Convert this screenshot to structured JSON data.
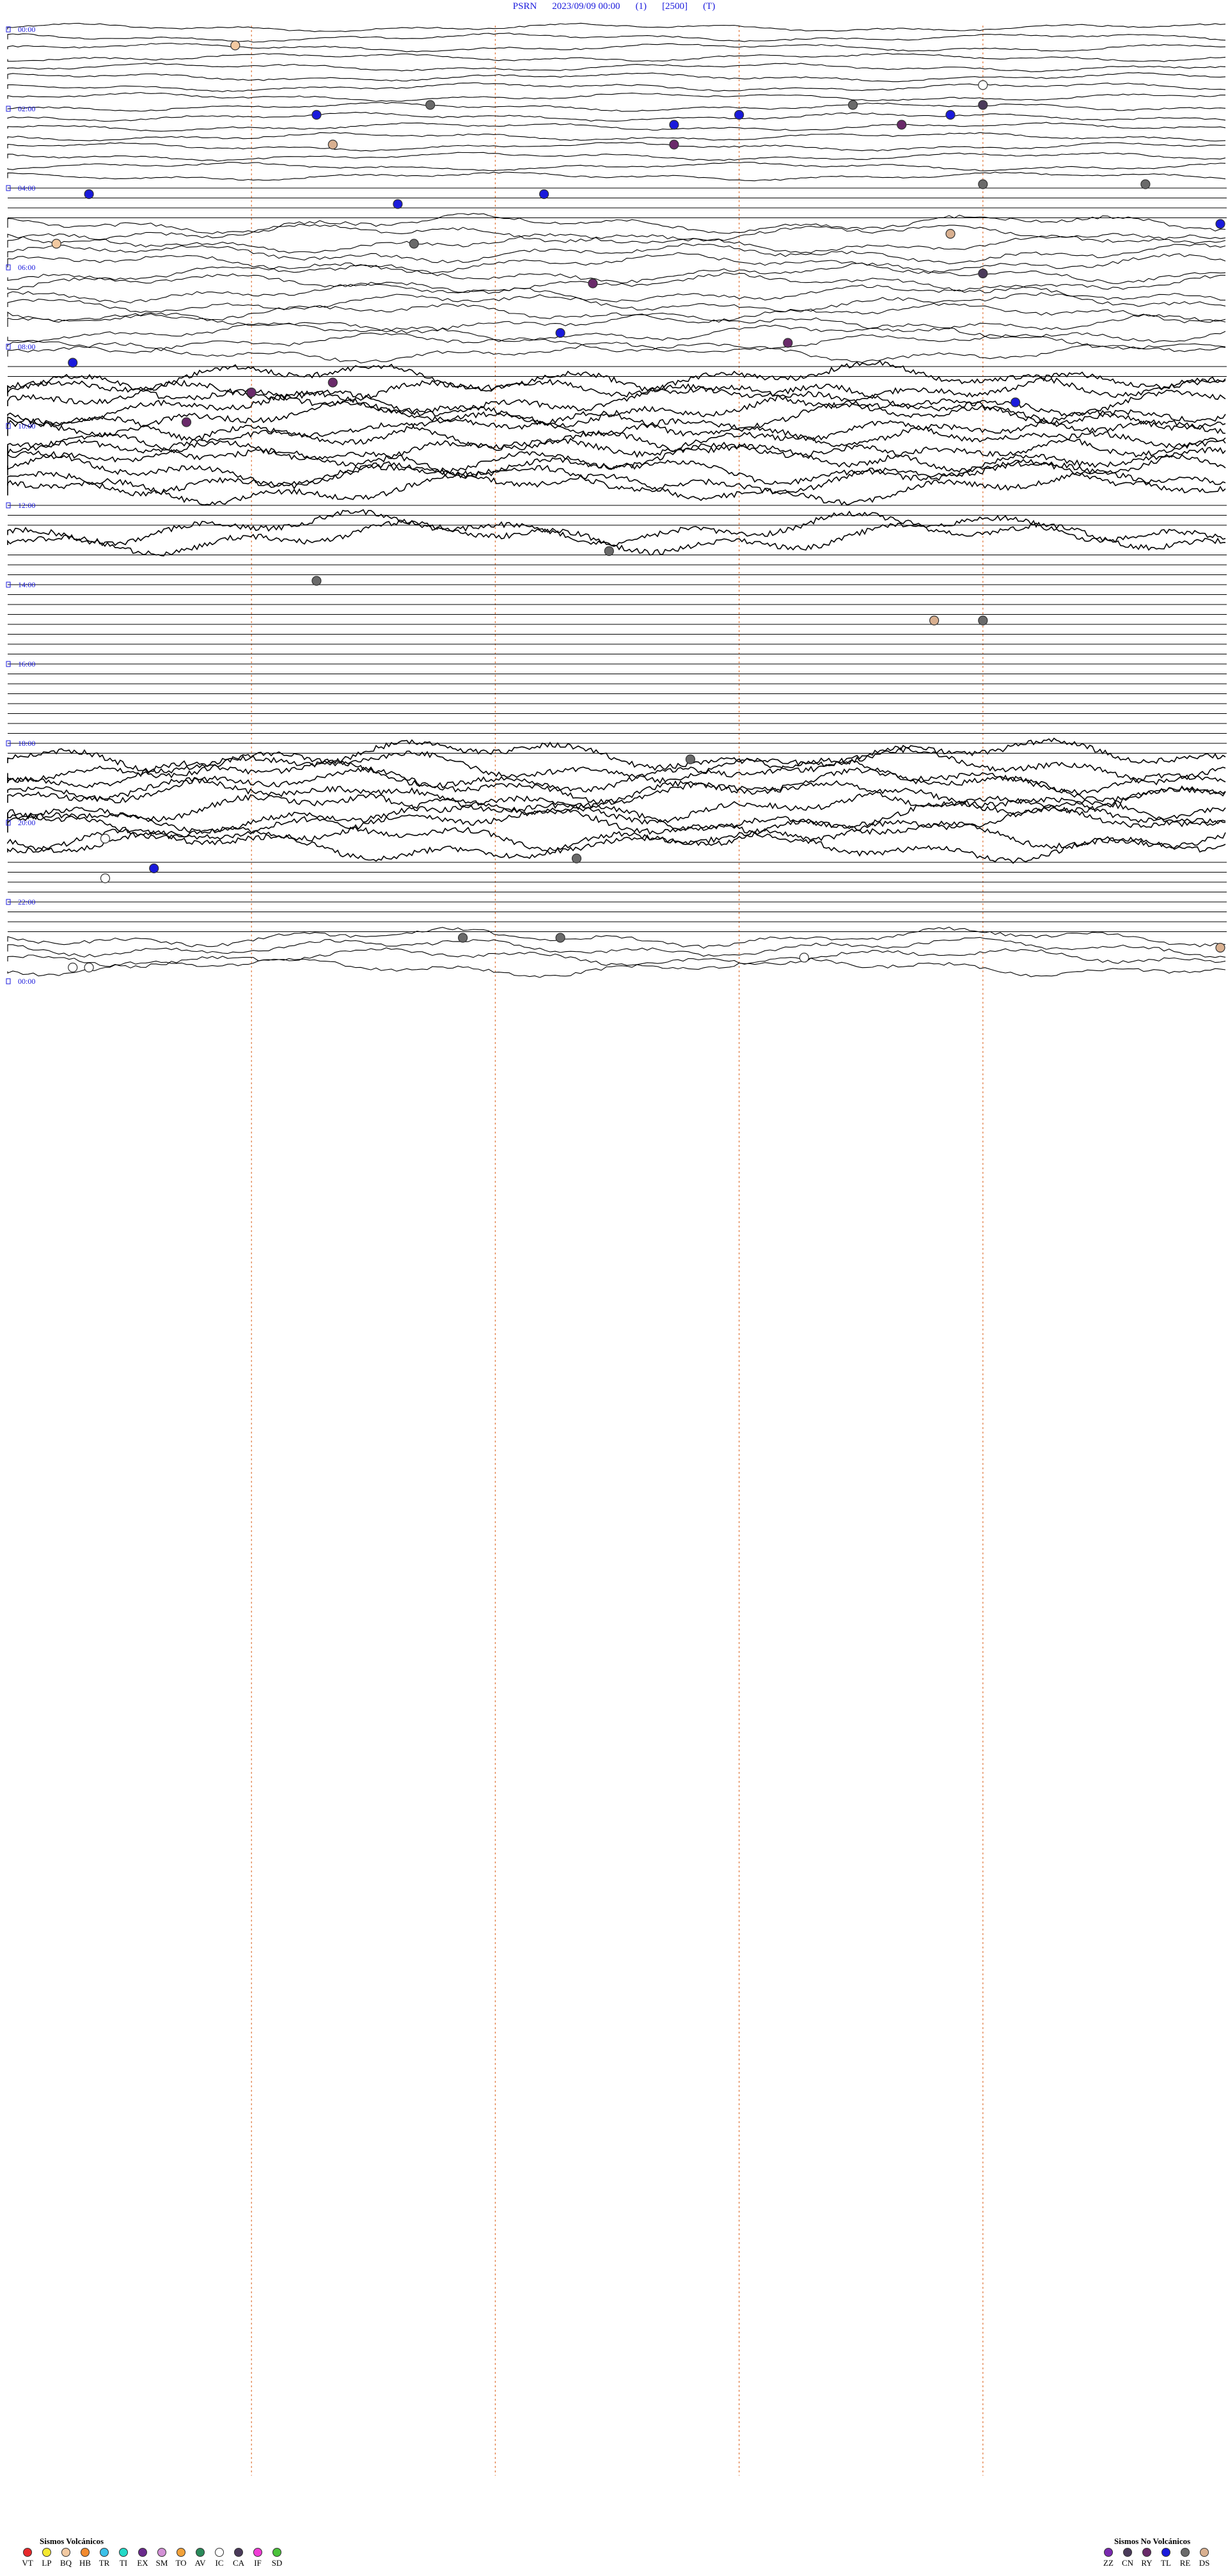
{
  "header": {
    "station": "PSRN",
    "datetime": "2023/09/09 00:00",
    "channel": "(1)",
    "scale": "[2500]",
    "component": "(T)"
  },
  "chart_data": {
    "type": "helicorder",
    "title": "PSRN 2023/09/09 00:00 (1) [2500] (T)",
    "hour_labels": [
      "00:00",
      "02:00",
      "04:00",
      "06:00",
      "08:00",
      "10:00",
      "12:00",
      "14:00",
      "16:00",
      "18:00",
      "20:00",
      "22:00",
      "00:00"
    ],
    "trace_count": 96,
    "minute_marks": 5,
    "line_color": "#000000",
    "label_color": "#1a1adc",
    "marker_color": "#e0763a",
    "activity": [
      {
        "from_hour": 0,
        "to_hour": 2,
        "level": "low"
      },
      {
        "from_hour": 2,
        "to_hour": 4,
        "level": "low"
      },
      {
        "from_hour": 5,
        "to_hour": 7,
        "level": "moderate"
      },
      {
        "from_hour": 7,
        "to_hour": 8.5,
        "level": "moderate"
      },
      {
        "from_hour": 9,
        "to_hour": 12,
        "level": "high"
      },
      {
        "from_hour": 12.7,
        "to_hour": 13.1,
        "level": "high"
      },
      {
        "from_hour": 18.5,
        "to_hour": 21,
        "level": "high"
      },
      {
        "from_hour": 23,
        "to_hour": 24,
        "level": "moderate"
      }
    ],
    "events": [
      {
        "hour": 0.5,
        "minute": 14,
        "type": "BQ"
      },
      {
        "hour": 1.5,
        "minute": 60,
        "type": "IC"
      },
      {
        "hour": 2.0,
        "minute": 26,
        "type": "RE"
      },
      {
        "hour": 2.0,
        "minute": 52,
        "type": "RE"
      },
      {
        "hour": 2.0,
        "minute": 60,
        "type": "CN"
      },
      {
        "hour": 2.25,
        "minute": 45,
        "type": "TL"
      },
      {
        "hour": 2.25,
        "minute": 58,
        "type": "TL"
      },
      {
        "hour": 2.25,
        "minute": 19,
        "type": "TL"
      },
      {
        "hour": 2.5,
        "minute": 55,
        "type": "RY"
      },
      {
        "hour": 2.5,
        "minute": 41,
        "type": "TL"
      },
      {
        "hour": 3.0,
        "minute": 41,
        "type": "RY"
      },
      {
        "hour": 3.0,
        "minute": 20,
        "type": "DS"
      },
      {
        "hour": 4.0,
        "minute": 60,
        "type": "RE"
      },
      {
        "hour": 4.0,
        "minute": 70,
        "type": "RE"
      },
      {
        "hour": 4.25,
        "minute": 5,
        "type": "TL"
      },
      {
        "hour": 4.5,
        "minute": 24,
        "type": "TL"
      },
      {
        "hour": 4.25,
        "minute": 33,
        "type": "TL"
      },
      {
        "hour": 5.25,
        "minute": 58,
        "type": "DS"
      },
      {
        "hour": 5.0,
        "minute": 75,
        "type": "TL"
      },
      {
        "hour": 5.5,
        "minute": 3,
        "type": "BQ"
      },
      {
        "hour": 5.5,
        "minute": 25,
        "type": "RE"
      },
      {
        "hour": 6.25,
        "minute": 60,
        "type": "CN"
      },
      {
        "hour": 6.5,
        "minute": 36,
        "type": "RY"
      },
      {
        "hour": 7.75,
        "minute": 34,
        "type": "TL"
      },
      {
        "hour": 8.0,
        "minute": 48,
        "type": "RY"
      },
      {
        "hour": 8.5,
        "minute": 4,
        "type": "TL"
      },
      {
        "hour": 9.0,
        "minute": 20,
        "type": "RY"
      },
      {
        "hour": 9.25,
        "minute": 15,
        "type": "RY"
      },
      {
        "hour": 9.5,
        "minute": 62,
        "type": "TL"
      },
      {
        "hour": 10.0,
        "minute": 11,
        "type": "RY"
      },
      {
        "hour": 13.25,
        "minute": 37,
        "type": "RE"
      },
      {
        "hour": 14.0,
        "minute": 19,
        "type": "RE"
      },
      {
        "hour": 15.0,
        "minute": 57,
        "type": "DS"
      },
      {
        "hour": 15.0,
        "minute": 60,
        "type": "RE"
      },
      {
        "hour": 18.5,
        "minute": 42,
        "type": "RE"
      },
      {
        "hour": 20.5,
        "minute": 6,
        "type": "IC"
      },
      {
        "hour": 21.0,
        "minute": 35,
        "type": "RE"
      },
      {
        "hour": 21.25,
        "minute": 9,
        "type": "TL"
      },
      {
        "hour": 21.5,
        "minute": 6,
        "type": "IC"
      },
      {
        "hour": 23.0,
        "minute": 28,
        "type": "RE"
      },
      {
        "hour": 23.0,
        "minute": 34,
        "type": "RE"
      },
      {
        "hour": 23.25,
        "minute": 76,
        "type": "DS"
      },
      {
        "hour": 23.75,
        "minute": 5,
        "type": "IC"
      },
      {
        "hour": 23.5,
        "minute": 49,
        "type": "IC"
      },
      {
        "hour": 23.75,
        "minute": 4,
        "type": "IC"
      }
    ]
  },
  "legend": {
    "volcanic_title": "Sismos Volcánicos",
    "nonvolcanic_title": "Sismos No Volcánicos",
    "volcanic": [
      {
        "code": "VT",
        "color": "#e8292c"
      },
      {
        "code": "LP",
        "color": "#f5e92f"
      },
      {
        "code": "BQ",
        "color": "#f2c9a1"
      },
      {
        "code": "HB",
        "color": "#f28a2e"
      },
      {
        "code": "TR",
        "color": "#3cc0e8"
      },
      {
        "code": "TI",
        "color": "#23d9c7"
      },
      {
        "code": "EX",
        "color": "#6a2a8c"
      },
      {
        "code": "SM",
        "color": "#d391d6"
      },
      {
        "code": "TO",
        "color": "#f2a23a"
      },
      {
        "code": "AV",
        "color": "#2a8a5a"
      },
      {
        "code": "IC",
        "color": "#ffffff"
      },
      {
        "code": "CA",
        "color": "#4a3a5a"
      },
      {
        "code": "IF",
        "color": "#f03cd6"
      },
      {
        "code": "SD",
        "color": "#4ac23a"
      }
    ],
    "nonvolcanic": [
      {
        "code": "ZZ",
        "color": "#7a2ab0"
      },
      {
        "code": "CN",
        "color": "#4a3a5a"
      },
      {
        "code": "RY",
        "color": "#6a2a6a"
      },
      {
        "code": "TL",
        "color": "#1a1adc"
      },
      {
        "code": "RE",
        "color": "#6a6a6a"
      },
      {
        "code": "DS",
        "color": "#d9b090"
      }
    ]
  }
}
